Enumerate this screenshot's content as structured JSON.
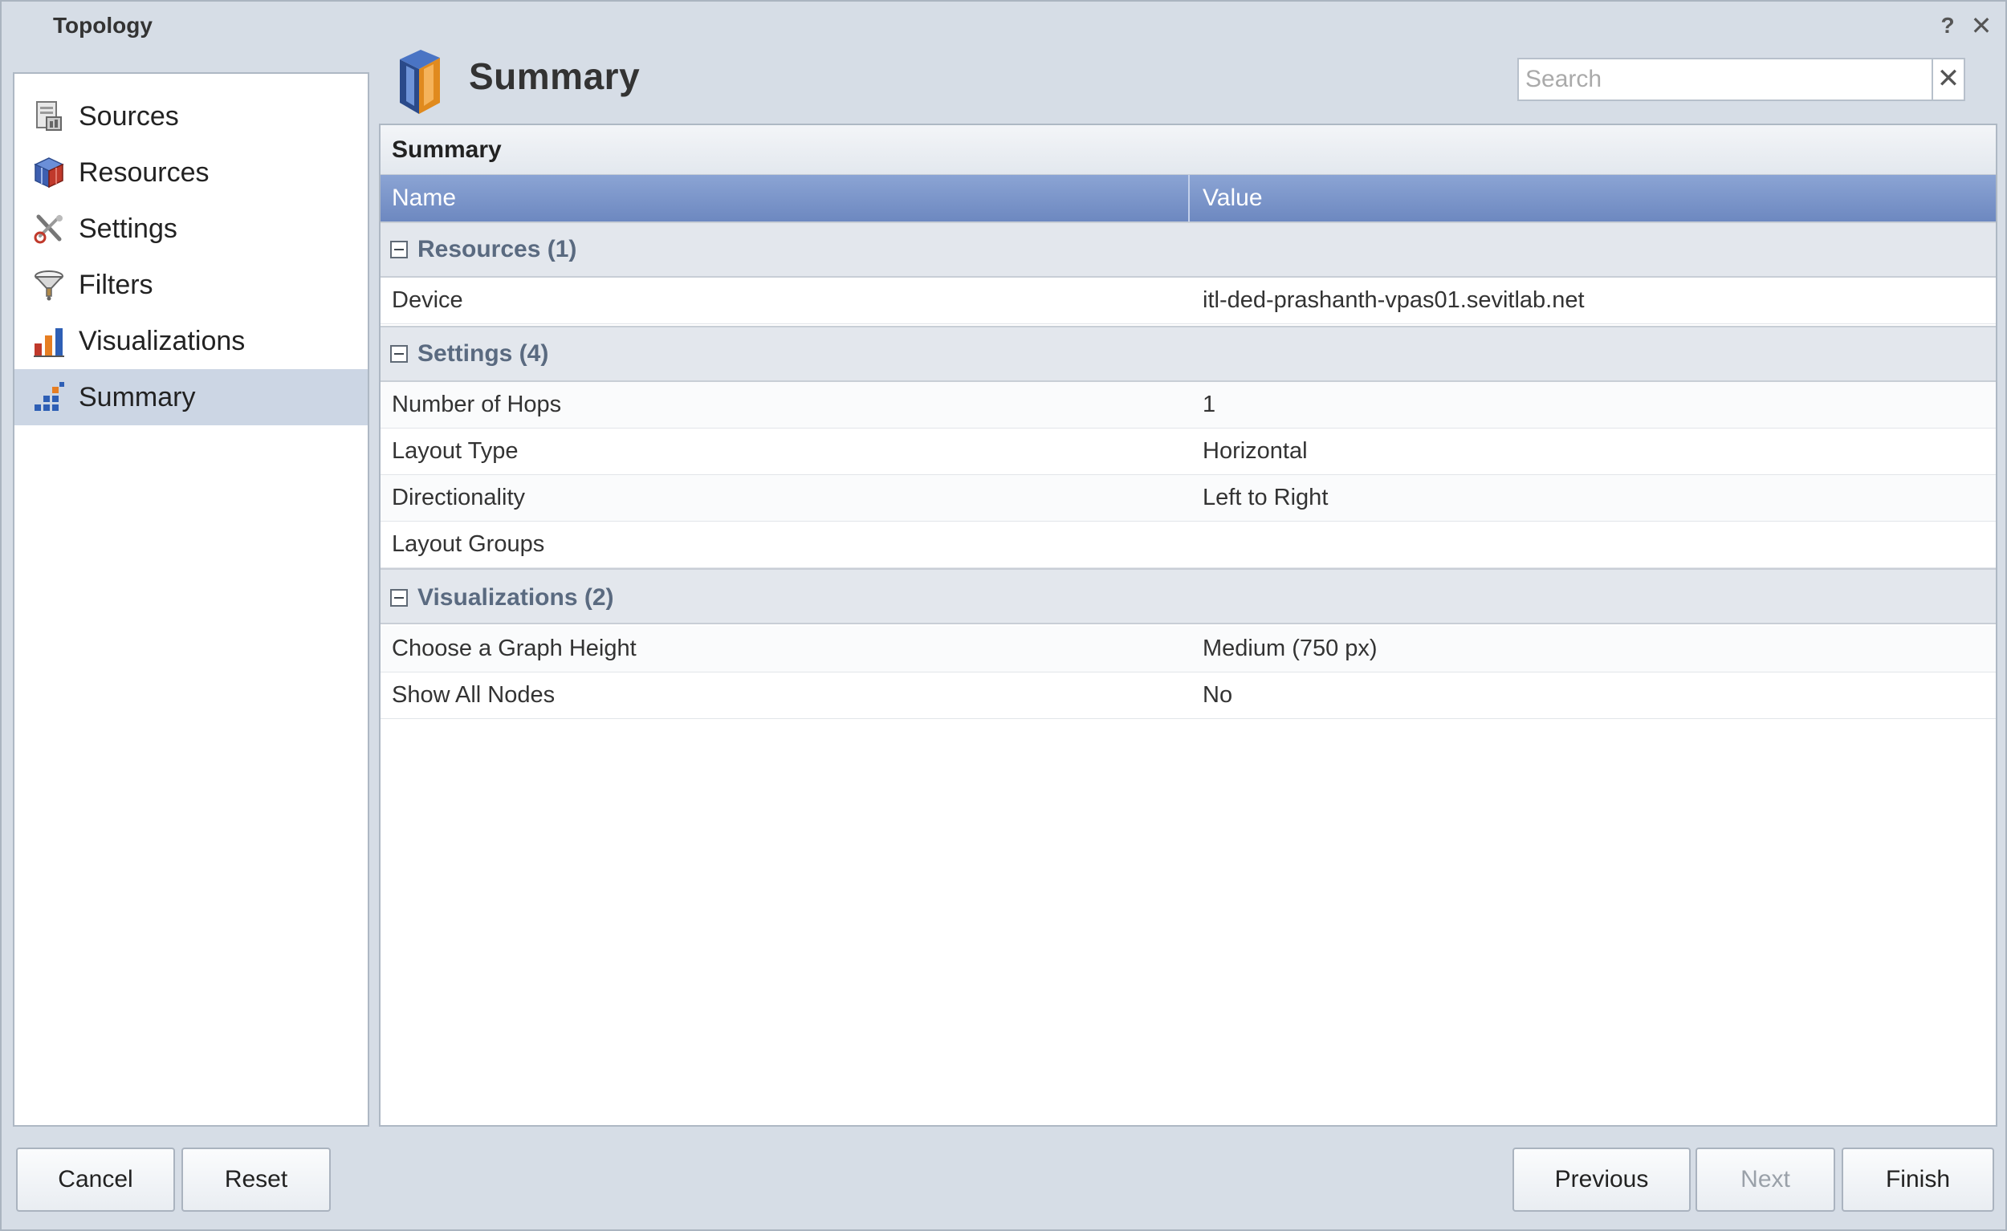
{
  "window": {
    "title": "Topology",
    "help_label": "?",
    "close_label": "✕"
  },
  "sidebar": {
    "items": [
      {
        "label": "Sources",
        "icon": "sources-icon"
      },
      {
        "label": "Resources",
        "icon": "resources-icon"
      },
      {
        "label": "Settings",
        "icon": "settings-icon"
      },
      {
        "label": "Filters",
        "icon": "filters-icon"
      },
      {
        "label": "Visualizations",
        "icon": "visualizations-icon"
      },
      {
        "label": "Summary",
        "icon": "summary-icon",
        "selected": true
      }
    ]
  },
  "main": {
    "title": "Summary",
    "search": {
      "placeholder": "Search",
      "value": "",
      "clear_label": "✕"
    }
  },
  "summary_panel": {
    "heading": "Summary",
    "columns": {
      "name": "Name",
      "value": "Value"
    },
    "groups": [
      {
        "title": "Resources (1)",
        "rows": [
          {
            "name": "Device",
            "value": "itl-ded-prashanth-vpas01.sevitlab.net"
          }
        ]
      },
      {
        "title": "Settings (4)",
        "rows": [
          {
            "name": "Number of Hops",
            "value": "1"
          },
          {
            "name": "Layout Type",
            "value": "Horizontal"
          },
          {
            "name": "Directionality",
            "value": "Left to Right"
          },
          {
            "name": "Layout Groups",
            "value": ""
          }
        ]
      },
      {
        "title": "Visualizations (2)",
        "rows": [
          {
            "name": "Choose a Graph Height",
            "value": "Medium (750 px)"
          },
          {
            "name": "Show All Nodes",
            "value": "No"
          }
        ]
      }
    ]
  },
  "footer": {
    "cancel": "Cancel",
    "reset": "Reset",
    "previous": "Previous",
    "next": "Next",
    "finish": "Finish"
  },
  "colors": {
    "selected_bg": "#ccd6e4",
    "column_header": "#7b96cc",
    "group_title": "#5a6a80"
  }
}
